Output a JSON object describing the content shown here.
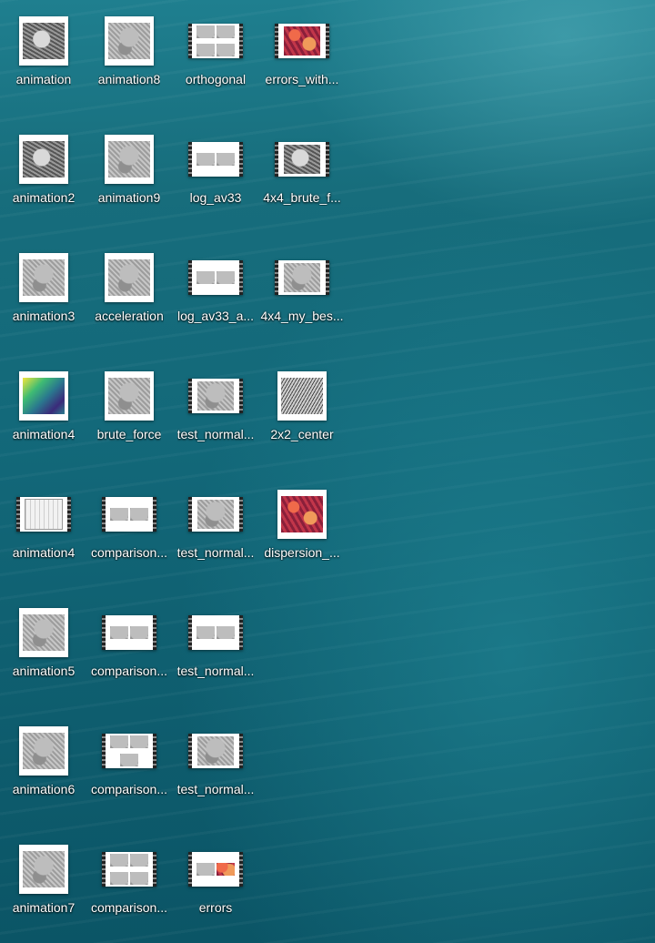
{
  "desktop": {
    "columns": [
      [
        {
          "label": "animation",
          "kind": "image",
          "style": "dark"
        },
        {
          "label": "animation2",
          "kind": "image",
          "style": "dark"
        },
        {
          "label": "animation3",
          "kind": "image",
          "style": "gray"
        },
        {
          "label": "animation4",
          "kind": "image",
          "style": "viridis"
        },
        {
          "label": "animation4",
          "kind": "video",
          "style": "plot"
        },
        {
          "label": "animation5",
          "kind": "image",
          "style": "gray"
        },
        {
          "label": "animation6",
          "kind": "image",
          "style": "gray"
        },
        {
          "label": "animation7",
          "kind": "image",
          "style": "gray"
        }
      ],
      [
        {
          "label": "animation8",
          "kind": "image",
          "style": "gray"
        },
        {
          "label": "animation9",
          "kind": "image",
          "style": "gray"
        },
        {
          "label": "acceleration",
          "kind": "image",
          "style": "gray"
        },
        {
          "label": "brute_force",
          "kind": "image",
          "style": "gray"
        },
        {
          "label": "comparison...",
          "kind": "video",
          "style": "pair"
        },
        {
          "label": "comparison...",
          "kind": "video",
          "style": "pair"
        },
        {
          "label": "comparison...",
          "kind": "video",
          "style": "triple"
        },
        {
          "label": "comparison...",
          "kind": "video",
          "style": "quad"
        }
      ],
      [
        {
          "label": "orthogonal",
          "kind": "video",
          "style": "quad"
        },
        {
          "label": "log_av33",
          "kind": "video",
          "style": "pair"
        },
        {
          "label": "log_av33_a...",
          "kind": "video",
          "style": "pair-small"
        },
        {
          "label": "test_normal...",
          "kind": "video",
          "style": "single"
        },
        {
          "label": "test_normal...",
          "kind": "video",
          "style": "single"
        },
        {
          "label": "test_normal...",
          "kind": "video",
          "style": "pair"
        },
        {
          "label": "test_normal...",
          "kind": "video",
          "style": "single"
        },
        {
          "label": "errors",
          "kind": "video",
          "style": "pair-red"
        }
      ],
      [
        {
          "label": "errors_with...",
          "kind": "video",
          "style": "red"
        },
        {
          "label": "4x4_brute_f...",
          "kind": "video",
          "style": "dark"
        },
        {
          "label": "4x4_my_bes...",
          "kind": "video",
          "style": "gray"
        },
        {
          "label": "2x2_center",
          "kind": "image",
          "style": "sketch"
        },
        {
          "label": "dispersion_...",
          "kind": "image",
          "style": "red"
        }
      ]
    ]
  }
}
